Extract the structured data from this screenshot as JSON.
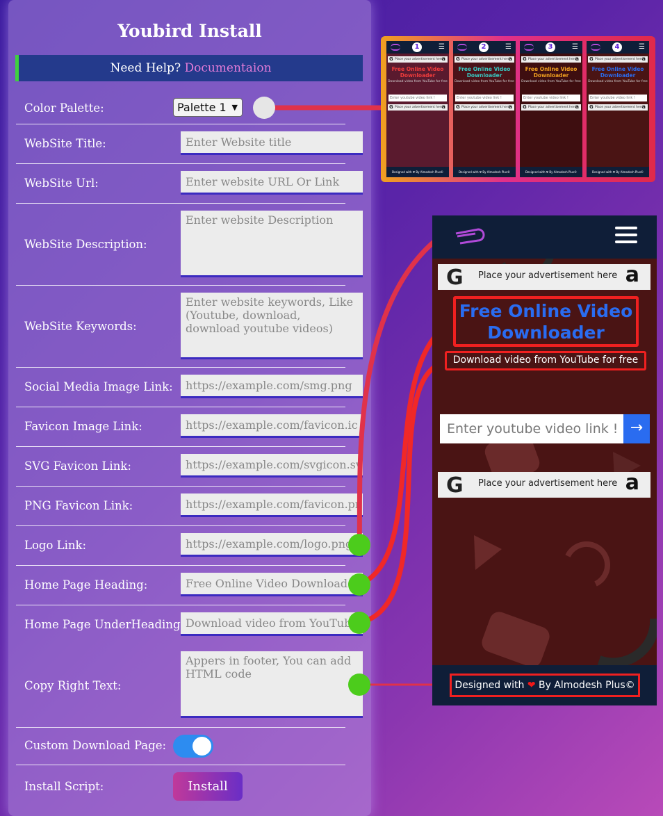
{
  "panel": {
    "title": "Youbird Install",
    "help_text": "Need Help?",
    "help_link": "Documentaion"
  },
  "fields": {
    "color_palette": {
      "label": "Color Palette:",
      "value": "Palette 1"
    },
    "website_title": {
      "label": "WebSite Title:",
      "placeholder": "Enter Website title"
    },
    "website_url": {
      "label": "WebSite Url:",
      "placeholder": "Enter website URL Or Link"
    },
    "website_description": {
      "label": "WebSite Description:",
      "placeholder": "Enter website Description"
    },
    "website_keywords": {
      "label": "WebSite Keywords:",
      "placeholder": "Enter website keywords, Like (Youtube, download, download youtube videos)"
    },
    "social_image": {
      "label": "Social Media Image Link:",
      "placeholder": "https://example.com/smg.png"
    },
    "favicon_image": {
      "label": "Favicon Image Link:",
      "placeholder": "https://example.com/favicon.ico"
    },
    "svg_favicon": {
      "label": "SVG Favicon Link:",
      "placeholder": "https://example.com/svgicon.svg"
    },
    "png_favicon": {
      "label": "PNG Favicon Link:",
      "placeholder": "https://example.com/favicon.png"
    },
    "logo_link": {
      "label": "Logo Link:",
      "placeholder": "https://example.com/logo.png"
    },
    "home_heading": {
      "label": "Home Page Heading:",
      "placeholder": "Free Online Video Downloader"
    },
    "home_underheading": {
      "label": "Home Page UnderHeading:",
      "placeholder": "Download video from YouTube for free"
    },
    "copyright": {
      "label": "Copy Right Text:",
      "placeholder": "Appers in footer, You can add HTML code"
    },
    "custom_download": {
      "label": "Custom Download Page:",
      "enabled": true
    },
    "install": {
      "label": "Install Script:",
      "button": "Install"
    }
  },
  "palettes": {
    "items": [
      {
        "num": "1",
        "heading_color": "#f03c3c",
        "bg": "#5a1a2e",
        "go": "#e03030"
      },
      {
        "num": "2",
        "heading_color": "#38c7c0",
        "bg": "#4a1218",
        "go": "#38c7c0"
      },
      {
        "num": "3",
        "heading_color": "#f0a020",
        "bg": "#3e0e10",
        "go": "#f0a020"
      },
      {
        "num": "4",
        "heading_color": "#2a6cf0",
        "bg": "#4a1414",
        "go": "#2a6cf0"
      }
    ],
    "mini_ad": "Place your advertisement here",
    "mini_heading": "Free Online Video Downloader",
    "mini_sub": "Download video from YouTube for free",
    "mini_input": "Enter youtube video link !",
    "mini_footer": "Designed with ❤ By Almodesh Plus©"
  },
  "preview": {
    "ad_text": "Place your advertisement here",
    "heading": "Free Online Video Downloader",
    "subheading": "Download video from YouTube for free",
    "input_placeholder": "Enter youtube video link !",
    "go_arrow": "→",
    "footer_prefix": "Designed with",
    "footer_heart": "❤",
    "footer_suffix": "By Almodesh Plus©",
    "accent": "#2a6cf0",
    "highlight": "#f02020",
    "connector_dot": "#4ccc1c"
  }
}
